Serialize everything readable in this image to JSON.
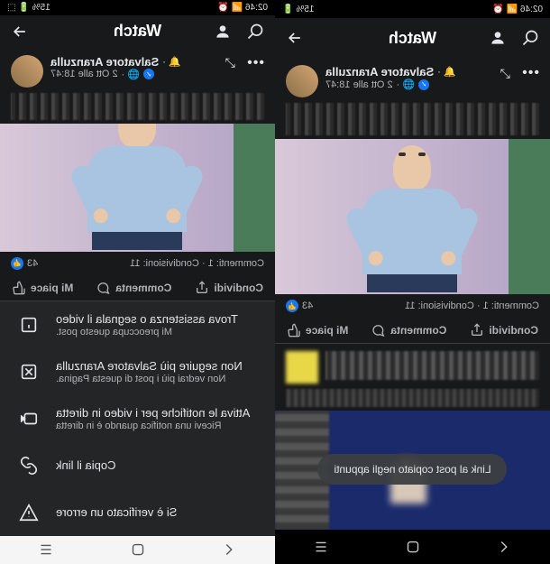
{
  "status_bar": {
    "time": "02:46",
    "battery": "15%"
  },
  "header": {
    "title": "Watch"
  },
  "post": {
    "author_name": "Salvatore Aranzulla",
    "timestamp": "2 Ott alle 18:47",
    "reaction_count": "43",
    "stats": "Commenti: 1 · Condivisioni: 11"
  },
  "actions": {
    "like": "Mi piace",
    "comment": "Commenta",
    "share": "Condividi"
  },
  "toast": {
    "message": "Link al post copiato negli appunti"
  },
  "sheet": {
    "items": [
      {
        "title": "Trova assistenza o segnala il video",
        "subtitle": "Mi preoccupa questo post.",
        "icon": "info"
      },
      {
        "title": "Non seguire più Salvatore Aranzulla",
        "subtitle": "Non vedrai più i post di questa Pagina.",
        "icon": "unfollow"
      },
      {
        "title": "Attiva le notifiche per i video in diretta",
        "subtitle": "Ricevi una notifica quando è in diretta",
        "icon": "live"
      },
      {
        "title": "Copia il link",
        "subtitle": "",
        "icon": "link"
      },
      {
        "title": "Si è verificato un errore",
        "subtitle": "",
        "icon": "warning"
      }
    ]
  }
}
